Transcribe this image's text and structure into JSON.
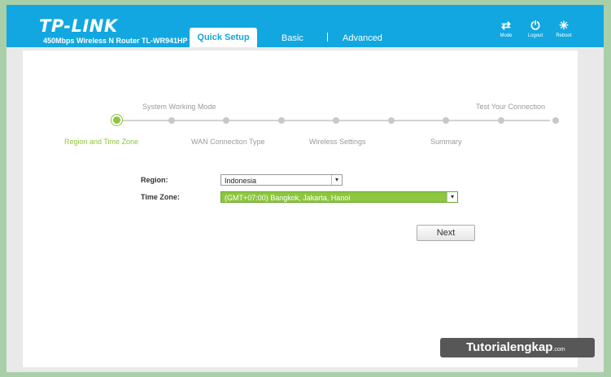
{
  "header": {
    "brand": "TP-LINK",
    "model": "450Mbps Wireless N Router TL-WR941HP",
    "tabs": [
      {
        "label": "Quick Setup",
        "active": true
      },
      {
        "label": "Basic",
        "active": false
      },
      {
        "label": "Advanced",
        "active": false
      }
    ],
    "tools": [
      {
        "label": "Mode",
        "icon": "mode-swap-icon"
      },
      {
        "label": "Logout",
        "icon": "power-icon"
      },
      {
        "label": "Reboot",
        "icon": "reboot-icon"
      }
    ],
    "accent": "#12a7e0"
  },
  "wizard": {
    "upper_labels": [
      "System Working Mode",
      "Test Your Connection"
    ],
    "lower_labels": [
      "Region and Time Zone",
      "WAN Connection Type",
      "Wireless Settings",
      "Summary"
    ],
    "active_step": "Region and Time Zone",
    "step_count": 9,
    "active_color": "#8dc63f"
  },
  "form": {
    "region_label": "Region:",
    "region_value": "Indonesia",
    "timezone_label": "Time Zone:",
    "timezone_value": "(GMT+07:00) Bangkok, Jakarta, Hanoi",
    "next_label": "Next"
  },
  "watermark": {
    "text": "Tutorialengkap",
    "suffix": ".com"
  }
}
